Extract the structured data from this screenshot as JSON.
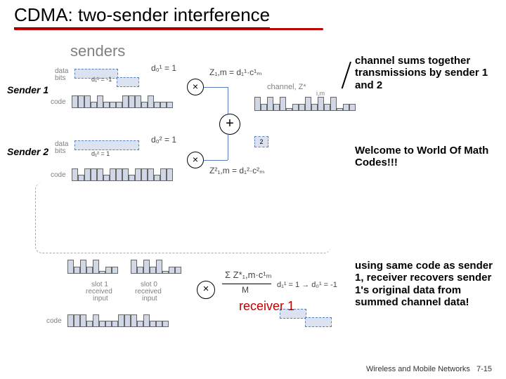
{
  "title": "CDMA: two-sender interference",
  "senders_label": "senders",
  "sender1_label": "Sender 1",
  "sender2_label": "Sender 2",
  "annotations": {
    "channel_sum": "channel sums together transmissions by sender 1 and 2",
    "welcome": "Welcome to World Of Math Codes!!!",
    "receiver": "using same code as sender 1, receiver recovers sender 1's original data from summed channel data!"
  },
  "receiver_label": "receiver 1",
  "footer": {
    "text": "Wireless and Mobile Networks",
    "page": "7-15"
  },
  "small_labels": {
    "data": "data",
    "bits": "bits",
    "code": "code",
    "channel": "channel, Z*",
    "slot1r": "slot 1",
    "slot0r": "slot 0",
    "recv_in": "received",
    "recv_in2": "input"
  },
  "formulas": {
    "d1": "d₀¹ = 1",
    "z1": "Z₁,m = d₁¹·c¹ₘ",
    "d1b": "d₁¹ = -1",
    "d2": "d₀² = 1",
    "z2": "Z²₁,m = d₁²·c²ₘ",
    "d2b": "d₁² = 1",
    "sum": "Σ Z*₁,m·c¹ₘ",
    "M": "M",
    "d1r": "d₁¹ = 1   →   d₀¹ = -1",
    "im": "i,m"
  },
  "codes": {
    "sender1_code": [
      1,
      1,
      1,
      -1,
      1,
      -1,
      -1,
      -1,
      1,
      1,
      1,
      -1,
      1,
      -1,
      -1,
      -1
    ],
    "sender2_code": [
      1,
      -1,
      1,
      1,
      1,
      -1,
      1,
      1,
      1,
      -1,
      1,
      1,
      1,
      -1,
      1,
      1
    ],
    "channel": [
      2,
      0,
      2,
      0,
      2,
      -2,
      0,
      0,
      2,
      0,
      2,
      0,
      2,
      -2,
      0,
      0
    ],
    "recv_slot1": [
      2,
      0,
      2,
      0,
      2,
      -2,
      0,
      0
    ],
    "recv_slot0": [
      2,
      0,
      2,
      0,
      2,
      -2,
      0,
      0
    ],
    "recv_code": [
      1,
      1,
      1,
      -1,
      1,
      -1,
      -1,
      -1,
      1,
      1,
      1,
      -1,
      1,
      -1,
      -1,
      -1
    ]
  }
}
